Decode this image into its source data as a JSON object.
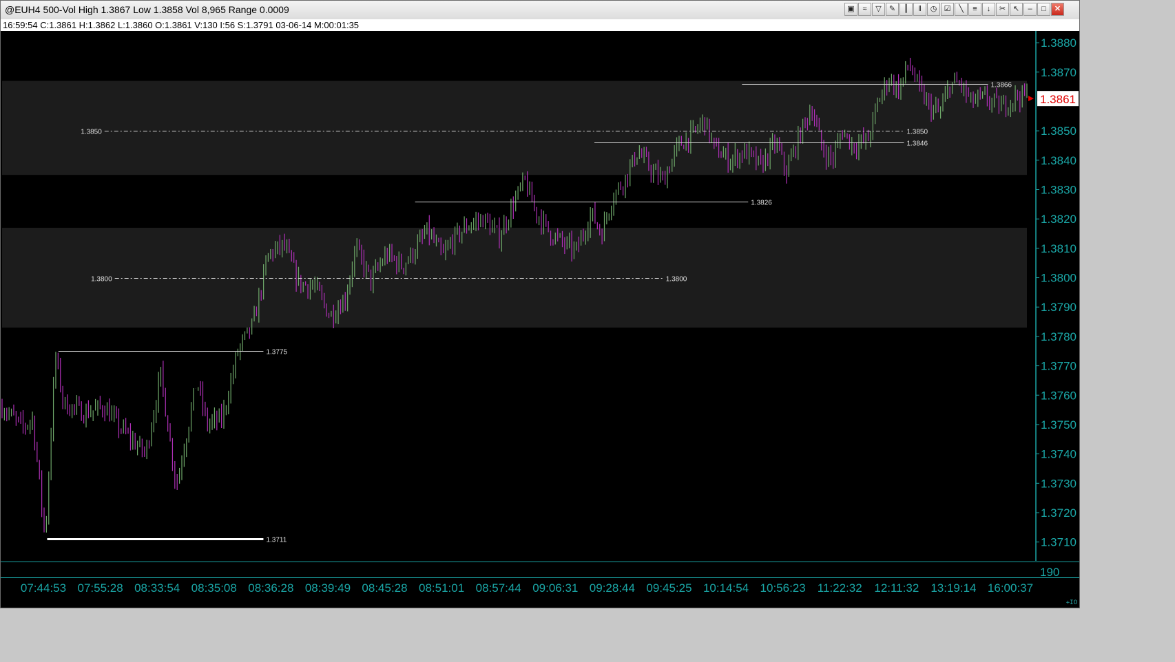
{
  "window": {
    "title": "@EUH4 500-Vol High 1.3867 Low 1.3858 Vol 8,965 Range 0.0009",
    "info_line": "16:59:54  C:1.3861  H:1.3862  L:1.3860  O:1.3861  V:130  I:56  S:1.3791  03-06-14  M:00:01:35",
    "toolbar_icons": [
      "chart-type-icon",
      "indicator-icon",
      "funnel-icon",
      "pencil-icon",
      "bar-style-icon",
      "candle-icon",
      "clock-icon",
      "checklist-icon",
      "drawing-line-icon",
      "fibonacci-icon",
      "arrow-down-icon",
      "trash-icon",
      "cursor-icon"
    ],
    "window_buttons": [
      "minimize-icon",
      "maximize-icon",
      "close-icon"
    ],
    "corner_label": "+IO"
  },
  "chart_data": {
    "type": "bar",
    "symbol": "@EUH4",
    "interval": "500-Vol",
    "ylim": [
      1.3705,
      1.3884
    ],
    "y_ticks": [
      "1.3880",
      "1.3870",
      "1.3850",
      "1.3840",
      "1.3830",
      "1.3820",
      "1.3810",
      "1.3800",
      "1.3790",
      "1.3780",
      "1.3770",
      "1.3760",
      "1.3750",
      "1.3740",
      "1.3730",
      "1.3720",
      "1.3710"
    ],
    "last_price": "1.3861",
    "volume_scale_label": "190",
    "x_labels": [
      "07:44:53",
      "07:55:28",
      "08:33:54",
      "08:35:08",
      "08:36:28",
      "08:39:49",
      "08:45:28",
      "08:51:01",
      "08:57:44",
      "09:06:31",
      "09:28:44",
      "09:45:25",
      "10:14:54",
      "10:56:23",
      "11:22:32",
      "12:11:32",
      "13:19:14",
      "16:00:37"
    ],
    "zones": [
      {
        "from": 1.3835,
        "to": 1.3867
      },
      {
        "from": 1.3783,
        "to": 1.3817
      }
    ],
    "levels": [
      {
        "value": 1.3866,
        "label": "1.3866",
        "style": "solid",
        "x0": 0.722,
        "x1": 0.962,
        "label_pos": "right"
      },
      {
        "value": 1.385,
        "label": "1.3850",
        "style": "dashdot",
        "x0": 0.1,
        "x1": 0.88,
        "label_pos": "both"
      },
      {
        "value": 1.3846,
        "label": "1.3846",
        "style": "solid",
        "x0": 0.578,
        "x1": 0.88,
        "label_pos": "right"
      },
      {
        "value": 1.3826,
        "label": "1.3826",
        "style": "solid",
        "x0": 0.403,
        "x1": 0.728,
        "label_pos": "right"
      },
      {
        "value": 1.38,
        "label": "1.3800",
        "style": "dashdot",
        "x0": 0.11,
        "x1": 0.645,
        "label_pos": "both"
      },
      {
        "value": 1.3775,
        "label": "1.3775",
        "style": "solid",
        "x0": 0.055,
        "x1": 0.255,
        "label_pos": "right"
      },
      {
        "value": 1.3711,
        "label": "1.3711",
        "style": "solid-thick",
        "x0": 0.044,
        "x1": 0.255,
        "label_pos": "right"
      }
    ],
    "price_path": [
      [
        0.0,
        1.3756
      ],
      [
        0.02,
        1.3749
      ],
      [
        0.03,
        1.3752
      ],
      [
        0.042,
        1.3711
      ],
      [
        0.052,
        1.3774
      ],
      [
        0.06,
        1.3757
      ],
      [
        0.08,
        1.3754
      ],
      [
        0.1,
        1.3756
      ],
      [
        0.115,
        1.3749
      ],
      [
        0.14,
        1.374
      ],
      [
        0.155,
        1.3767
      ],
      [
        0.17,
        1.3729
      ],
      [
        0.19,
        1.3765
      ],
      [
        0.2,
        1.375
      ],
      [
        0.215,
        1.3752
      ],
      [
        0.23,
        1.3775
      ],
      [
        0.245,
        1.3784
      ],
      [
        0.26,
        1.3808
      ],
      [
        0.275,
        1.3811
      ],
      [
        0.29,
        1.3798
      ],
      [
        0.305,
        1.3797
      ],
      [
        0.32,
        1.3787
      ],
      [
        0.335,
        1.3793
      ],
      [
        0.345,
        1.381
      ],
      [
        0.36,
        1.3799
      ],
      [
        0.375,
        1.3808
      ],
      [
        0.39,
        1.3804
      ],
      [
        0.4,
        1.3808
      ],
      [
        0.415,
        1.3816
      ],
      [
        0.43,
        1.3807
      ],
      [
        0.44,
        1.3813
      ],
      [
        0.455,
        1.3818
      ],
      [
        0.47,
        1.382
      ],
      [
        0.485,
        1.3814
      ],
      [
        0.5,
        1.3826
      ],
      [
        0.51,
        1.3833
      ],
      [
        0.52,
        1.3823
      ],
      [
        0.535,
        1.3815
      ],
      [
        0.55,
        1.3811
      ],
      [
        0.56,
        1.3809
      ],
      [
        0.575,
        1.3822
      ],
      [
        0.585,
        1.3815
      ],
      [
        0.595,
        1.3827
      ],
      [
        0.61,
        1.3835
      ],
      [
        0.62,
        1.3843
      ],
      [
        0.635,
        1.3836
      ],
      [
        0.645,
        1.3833
      ],
      [
        0.66,
        1.3845
      ],
      [
        0.675,
        1.3849
      ],
      [
        0.685,
        1.3854
      ],
      [
        0.695,
        1.3844
      ],
      [
        0.71,
        1.384
      ],
      [
        0.725,
        1.3843
      ],
      [
        0.74,
        1.3838
      ],
      [
        0.755,
        1.3846
      ],
      [
        0.765,
        1.3836
      ],
      [
        0.78,
        1.385
      ],
      [
        0.79,
        1.3858
      ],
      [
        0.8,
        1.3844
      ],
      [
        0.81,
        1.384
      ],
      [
        0.82,
        1.385
      ],
      [
        0.83,
        1.3845
      ],
      [
        0.845,
        1.3847
      ],
      [
        0.855,
        1.386
      ],
      [
        0.865,
        1.3868
      ],
      [
        0.875,
        1.3864
      ],
      [
        0.885,
        1.3873
      ],
      [
        0.895,
        1.3864
      ],
      [
        0.905,
        1.3858
      ],
      [
        0.915,
        1.3856
      ],
      [
        0.925,
        1.3866
      ],
      [
        0.935,
        1.3866
      ],
      [
        0.945,
        1.386
      ],
      [
        0.96,
        1.3861
      ],
      [
        0.975,
        1.3858
      ],
      [
        0.99,
        1.3862
      ]
    ]
  }
}
